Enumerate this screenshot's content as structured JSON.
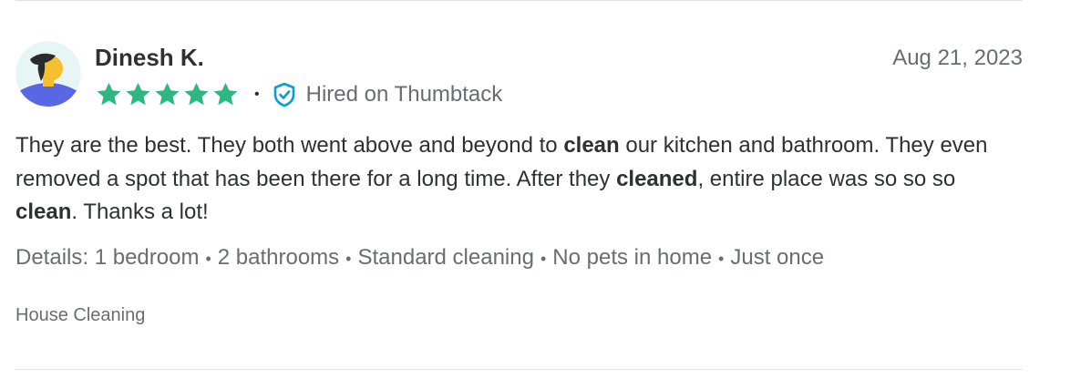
{
  "reviewer": {
    "name": "Dinesh K.",
    "date": "Aug 21, 2023",
    "rating": 5,
    "rating_max": 5
  },
  "badge": {
    "icon": "verified-shield-icon",
    "label": "Hired on Thumbtack"
  },
  "review": {
    "segments": [
      {
        "text": "They are the best. They both went above and beyond to ",
        "bold": false
      },
      {
        "text": "clean",
        "bold": true
      },
      {
        "text": " our kitchen and bathroom. They even removed a spot that has been there for a long time. After they ",
        "bold": false
      },
      {
        "text": "cleaned",
        "bold": true
      },
      {
        "text": ", entire place was so so so ",
        "bold": false
      },
      {
        "text": "clean",
        "bold": true
      },
      {
        "text": ". Thanks a lot!",
        "bold": false
      }
    ]
  },
  "details": {
    "prefix": "Details:",
    "items": [
      "1 bedroom",
      "2 bathrooms",
      "Standard cleaning",
      "No pets in home",
      "Just once"
    ],
    "separator": "•"
  },
  "category": "House Cleaning",
  "colors": {
    "star": "#2db783",
    "shield": "#009fd9",
    "text_primary": "#2f3033",
    "text_secondary": "#676d73",
    "divider": "#e1e3e5",
    "avatar_bg": "#e7f5f7",
    "avatar_shirt": "#5968e2",
    "avatar_skin": "#f5c02f"
  }
}
